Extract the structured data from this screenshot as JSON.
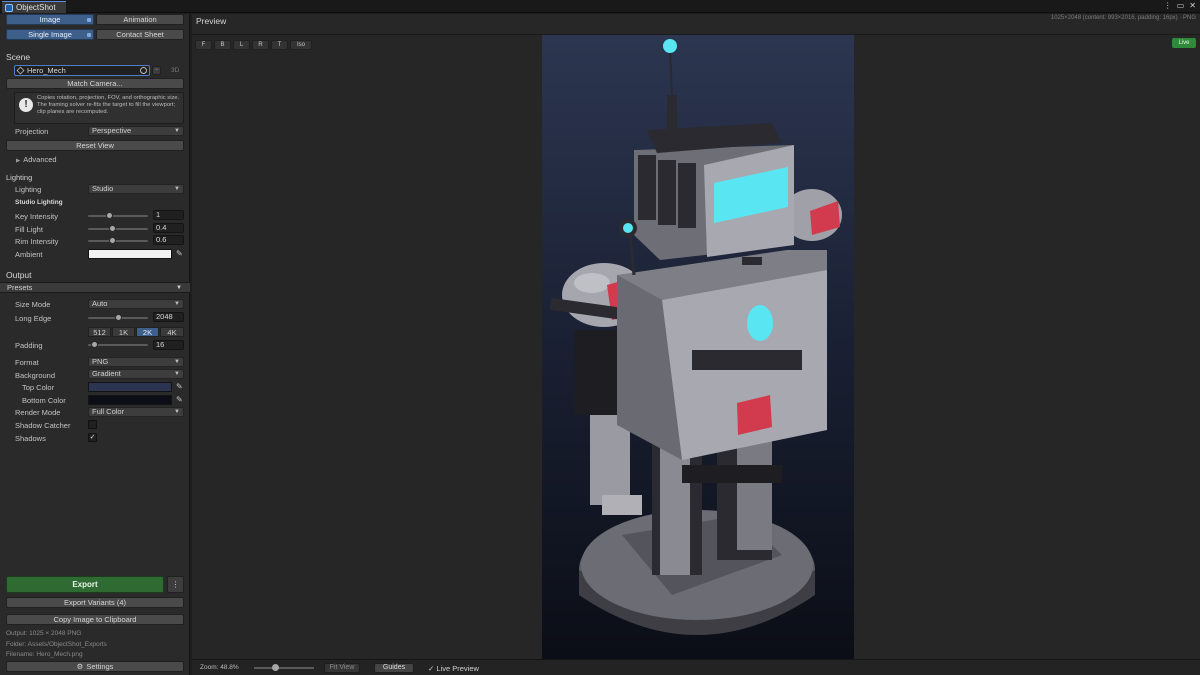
{
  "window": {
    "title": "ObjectShot",
    "controls": [
      "⋮",
      "▭",
      "✕"
    ]
  },
  "mode_tabs": [
    {
      "label": "Image",
      "selected": true
    },
    {
      "label": "Animation",
      "selected": false
    }
  ],
  "layout_tabs": [
    {
      "label": "Single Image",
      "selected": true
    },
    {
      "label": "Contact Sheet",
      "selected": false
    }
  ],
  "scene": {
    "heading": "Scene",
    "object": "Hero_Mech",
    "view_label": "3D",
    "match_camera": "Match Camera...",
    "info": "Copies rotation, projection, FOV, and orthographic size. The framing solver re-fits the target to fill the viewport; clip planes are recomputed.",
    "projection_label": "Projection",
    "projection_value": "Perspective",
    "reset_view": "Reset View",
    "advanced": "Advanced"
  },
  "lighting": {
    "heading": "Lighting",
    "lighting_label": "Lighting",
    "lighting_value": "Studio",
    "sub_heading": "Studio Lighting",
    "key_label": "Key Intensity",
    "key_value": "1",
    "key_fraction": 0.35,
    "fill_label": "Fill Light",
    "fill_value": "0.4",
    "fill_fraction": 0.4,
    "rim_label": "Rim Intensity",
    "rim_value": "0.6",
    "rim_fraction": 0.4,
    "ambient_label": "Ambient",
    "ambient_color": "#f2f2f2"
  },
  "output": {
    "heading": "Output",
    "presets": "Presets",
    "size_mode_label": "Size Mode",
    "size_mode_value": "Auto",
    "long_edge_label": "Long Edge",
    "long_edge_value": "2048",
    "long_edge_fraction": 0.5,
    "size_buttons": [
      {
        "label": "512",
        "selected": false
      },
      {
        "label": "1K",
        "selected": false
      },
      {
        "label": "2K",
        "selected": true
      },
      {
        "label": "4K",
        "selected": false
      }
    ],
    "padding_label": "Padding",
    "padding_value": "16",
    "padding_fraction": 0.1,
    "format_label": "Format",
    "format_value": "PNG",
    "background_label": "Background",
    "background_value": "Gradient",
    "top_color_label": "Top Color",
    "top_color": "#2b3552",
    "bottom_color_label": "Bottom Color",
    "bottom_color": "#0b0e16",
    "render_mode_label": "Render Mode",
    "render_mode_value": "Full Color",
    "shadow_catcher_label": "Shadow Catcher",
    "shadow_catcher_checked": false,
    "shadows_label": "Shadows",
    "shadows_checked": true
  },
  "actions": {
    "export": "Export",
    "export_more": "⋮",
    "export_variants": "Export Variants (4)",
    "copy_clipboard": "Copy Image to Clipboard",
    "output_info": "Output: 1025 × 2048 PNG",
    "folder_info": "Folder: Assets/ObjectShot_Exports",
    "filename_info": "Filename: Hero_Mech.png",
    "settings": "Settings"
  },
  "preview": {
    "title": "Preview",
    "info": "1025×2048 (content: 993×2016, padding: 16px) · PNG",
    "view_buttons": [
      "F",
      "B",
      "L",
      "R",
      "T",
      "Iso"
    ],
    "live_badge": "Live",
    "zoom_label": "Zoom: 48.8%",
    "zoom_fraction": 0.35,
    "fit_view": "Fit View",
    "guides": "Guides",
    "live_preview": "Live Preview",
    "live_preview_checked": true
  },
  "colors": {
    "accent": "#3d5f8a",
    "export_green": "#2f6a33",
    "live_green": "#2e8a39",
    "mech_glow": "#59e6f2",
    "mech_panel": "#d23a4e"
  }
}
